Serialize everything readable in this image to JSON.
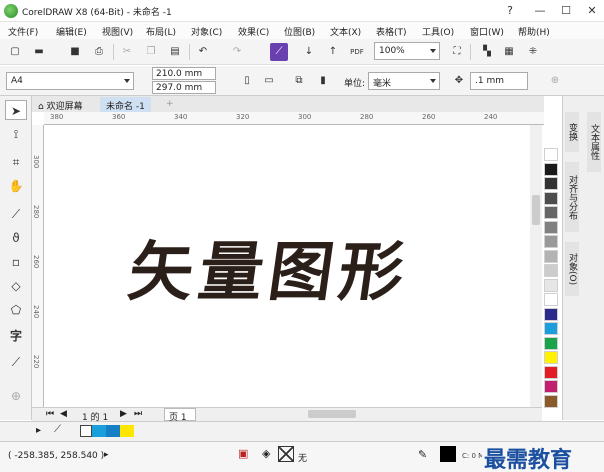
{
  "app": {
    "title": "CorelDRAW X8 (64-Bit) - 未命名 -1"
  },
  "window_buttons": [
    "?",
    "—",
    "☐",
    "✕"
  ],
  "menu": [
    "文件(F)",
    "编辑(E)",
    "视图(V)",
    "布局(L)",
    "对象(C)",
    "效果(C)",
    "位图(B)",
    "文本(X)",
    "表格(T)",
    "工具(O)",
    "窗口(W)",
    "帮助(H)"
  ],
  "toolbar": {
    "zoom": "100%"
  },
  "property_bar": {
    "page_size": "A4",
    "width": "210.0 mm",
    "height": "297.0 mm",
    "units_label": "单位:",
    "units": "毫米",
    "nudge": ".1 mm"
  },
  "tabs": {
    "welcome": "欢迎屏幕",
    "document": "未命名 -1"
  },
  "rulers": {
    "h_ticks": [
      "380",
      "360",
      "340",
      "320",
      "300",
      "280",
      "260",
      "240"
    ],
    "v_ticks": [
      "300",
      "280",
      "260",
      "240",
      "220",
      "200"
    ]
  },
  "canvas": {
    "artwork_text": "矢量图形"
  },
  "page_nav": {
    "page_info": "1 的 1",
    "page_tab": "页 1"
  },
  "dock_tabs": [
    "变换",
    "对齐与分布",
    "对象(O)",
    "文本属性"
  ],
  "palette": [
    "#ffffff",
    "#1a1a1a",
    "#333333",
    "#4d4d4d",
    "#666666",
    "#808080",
    "#999999",
    "#b3b3b3",
    "#cccccc",
    "#e6e6e6",
    "#ffffff",
    "#2b2b8c",
    "#1a9fdc",
    "#1ba34a",
    "#fff200",
    "#e31d25",
    "#c21f6e",
    "#8b5a2b"
  ],
  "colorbar": {
    "swatches": [
      "#ffffff",
      "#1a9fdc",
      "#1580c6",
      "#ffe600"
    ]
  },
  "status": {
    "coords": "( -258.385, 258.540 )",
    "fill_label": "无",
    "info": "C: 0 M: 0 Y: 0 K: 100  .200 mm"
  },
  "watermark": "最需教育"
}
